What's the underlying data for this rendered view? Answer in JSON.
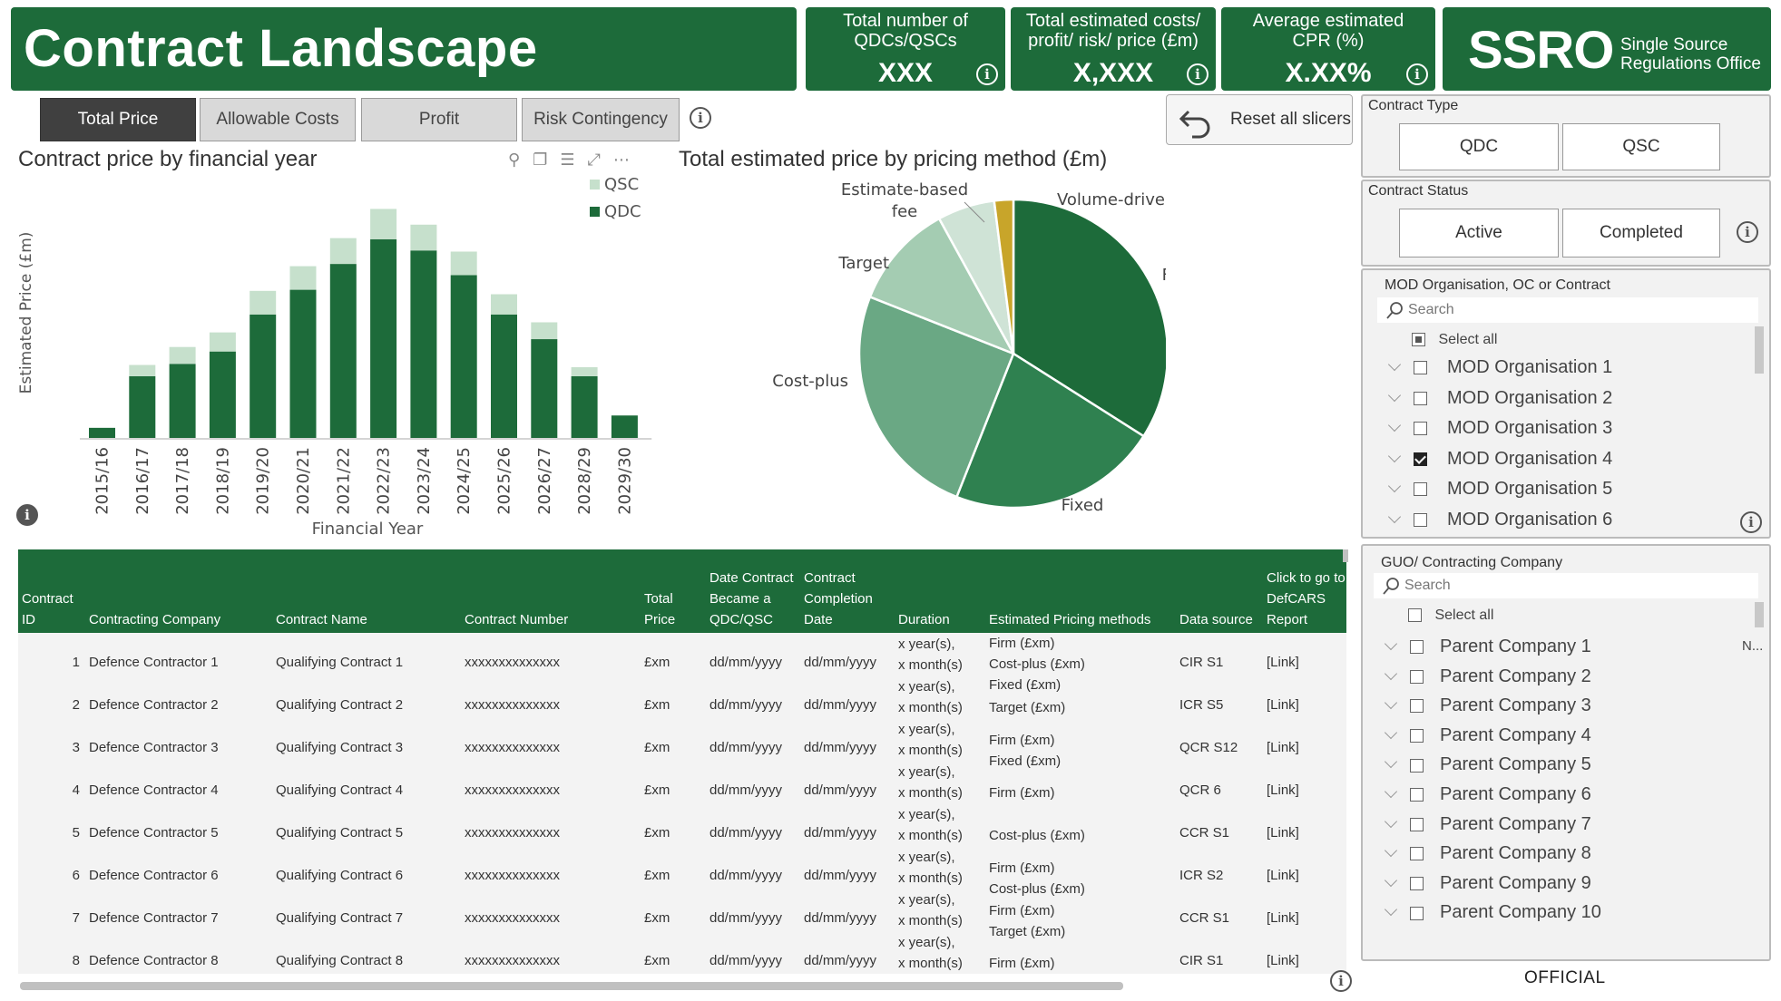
{
  "header": {
    "title": "Contract Landscape",
    "kpis": [
      {
        "label": "Total number of QDCs/QSCs",
        "value": "XXX"
      },
      {
        "label": "Total estimated costs/ profit/ risk/ price (£m)",
        "value": "X,XXX"
      },
      {
        "label": "Average estimated CPR (%)",
        "value": "X.XX%"
      }
    ],
    "logo_main": "SSRO",
    "logo_sub": "Single Source Regulations Office",
    "info_glyph": "i"
  },
  "tabs": [
    {
      "label": "Total Price",
      "active": true
    },
    {
      "label": "Allowable Costs",
      "active": false
    },
    {
      "label": "Profit",
      "active": false
    },
    {
      "label": "Risk Contingency",
      "active": false
    }
  ],
  "reset_label": "Reset all slicers",
  "bar_chart_title": "Contract price by financial year",
  "pie_chart_title": "Total estimated price by pricing method (£m)",
  "chart_data": [
    {
      "type": "bar",
      "stacked": true,
      "title": "Contract price by financial year",
      "xlabel": "Financial Year",
      "ylabel": "Estimated Price (£m)",
      "categories": [
        "2015/16",
        "2016/17",
        "2017/18",
        "2018/19",
        "2019/20",
        "2020/21",
        "2021/22",
        "2022/23",
        "2023/24",
        "2024/25",
        "2025/26",
        "2026/27",
        "2028/29",
        "2029/30"
      ],
      "series": [
        {
          "name": "QDC",
          "color": "#1d6b3a",
          "values": [
            9,
            55,
            66,
            77,
            110,
            132,
            155,
            177,
            167,
            145,
            110,
            88,
            55,
            20
          ]
        },
        {
          "name": "QSC",
          "color": "#c6e0cc",
          "values": [
            0,
            10,
            15,
            17,
            21,
            21,
            23,
            27,
            23,
            21,
            18,
            15,
            8,
            0
          ]
        }
      ],
      "legend_position": "top-right",
      "ylim": [
        0,
        210
      ],
      "grid": false
    },
    {
      "type": "pie",
      "title": "Total estimated price by pricing method (£m)",
      "slices": [
        {
          "label": "Firm",
          "value": 34,
          "color": "#1d6b3a"
        },
        {
          "label": "Fixed",
          "value": 22,
          "color": "#2f8150"
        },
        {
          "label": "Cost-plus",
          "value": 25,
          "color": "#6aa884"
        },
        {
          "label": "Target",
          "value": 11,
          "color": "#a4ccb2"
        },
        {
          "label": "Estimate-based fee",
          "value": 6,
          "color": "#cfe3d6"
        },
        {
          "label": "Volume-driven",
          "value": 2,
          "color": "#c8a52a"
        }
      ]
    }
  ],
  "slicers": {
    "contract_type": {
      "title": "Contract Type",
      "options": [
        "QDC",
        "QSC"
      ]
    },
    "contract_status": {
      "title": "Contract Status",
      "options": [
        "Active",
        "Completed"
      ]
    },
    "mod_org": {
      "title": "MOD Organisation, OC or Contract",
      "search_placeholder": "Search",
      "select_all": "Select all",
      "items": [
        {
          "label": "MOD Organisation 1",
          "checked": false
        },
        {
          "label": "MOD Organisation 2",
          "checked": false
        },
        {
          "label": "MOD Organisation 3",
          "checked": false
        },
        {
          "label": "MOD Organisation 4",
          "checked": true
        },
        {
          "label": "MOD Organisation 5",
          "checked": false
        },
        {
          "label": "MOD Organisation 6",
          "checked": false
        }
      ]
    },
    "guo": {
      "title": "GUO/ Contracting Company",
      "search_placeholder": "Search",
      "select_all": "Select all",
      "truncated_marker": "N...",
      "items": [
        {
          "label": "Parent Company 1"
        },
        {
          "label": "Parent Company 2"
        },
        {
          "label": "Parent Company 3"
        },
        {
          "label": "Parent Company 4"
        },
        {
          "label": "Parent Company 5"
        },
        {
          "label": "Parent Company 6"
        },
        {
          "label": "Parent Company 7"
        },
        {
          "label": "Parent Company 8"
        },
        {
          "label": "Parent Company 9"
        },
        {
          "label": "Parent Company 10"
        }
      ]
    }
  },
  "table": {
    "headers": [
      "Contract ID",
      "Contracting Company",
      "Contract Name",
      "Contract Number",
      "Total Price",
      "Date Contract Became a QDC/QSC",
      "Contract Completion Date",
      "Duration",
      "Estimated Pricing methods",
      "Data source",
      "Click to go to DefCARS Report"
    ],
    "rows": [
      {
        "id": "1",
        "company": "Defence Contractor 1",
        "name": "Qualifying Contract 1",
        "number": "xxxxxxxxxxxxxx",
        "price": "£xm",
        "became": "dd/mm/yyyy",
        "completion": "dd/mm/yyyy",
        "duration": [
          "x year(s),",
          "x month(s)"
        ],
        "methods": [
          "Firm (£xm)",
          "Cost-plus (£xm)",
          "Fixed (£xm)"
        ],
        "source": "CIR S1",
        "link": "[Link]"
      },
      {
        "id": "2",
        "company": "Defence Contractor 2",
        "name": "Qualifying Contract 2",
        "number": "xxxxxxxxxxxxxx",
        "price": "£xm",
        "became": "dd/mm/yyyy",
        "completion": "dd/mm/yyyy",
        "duration": [
          "x year(s),",
          "x month(s)"
        ],
        "methods": [
          "Target (£xm)"
        ],
        "source": "ICR S5",
        "link": "[Link]"
      },
      {
        "id": "3",
        "company": "Defence Contractor 3",
        "name": "Qualifying Contract 3",
        "number": "xxxxxxxxxxxxxx",
        "price": "£xm",
        "became": "dd/mm/yyyy",
        "completion": "dd/mm/yyyy",
        "duration": [
          "x year(s),",
          "x month(s)"
        ],
        "methods": [
          "Firm (£xm)",
          "Fixed (£xm)"
        ],
        "source": "QCR S12",
        "link": "[Link]"
      },
      {
        "id": "4",
        "company": "Defence Contractor 4",
        "name": "Qualifying Contract 4",
        "number": "xxxxxxxxxxxxxx",
        "price": "£xm",
        "became": "dd/mm/yyyy",
        "completion": "dd/mm/yyyy",
        "duration": [
          "x year(s),",
          "x month(s)"
        ],
        "methods": [
          "Firm (£xm)"
        ],
        "source": "QCR 6",
        "link": "[Link]"
      },
      {
        "id": "5",
        "company": "Defence Contractor 5",
        "name": "Qualifying Contract 5",
        "number": "xxxxxxxxxxxxxx",
        "price": "£xm",
        "became": "dd/mm/yyyy",
        "completion": "dd/mm/yyyy",
        "duration": [
          "x year(s),",
          "x month(s)"
        ],
        "methods": [
          "Cost-plus (£xm)"
        ],
        "source": "CCR S1",
        "link": "[Link]"
      },
      {
        "id": "6",
        "company": "Defence Contractor 6",
        "name": "Qualifying Contract 6",
        "number": "xxxxxxxxxxxxxx",
        "price": "£xm",
        "became": "dd/mm/yyyy",
        "completion": "dd/mm/yyyy",
        "duration": [
          "x year(s),",
          "x month(s)"
        ],
        "methods": [
          "Firm (£xm)",
          "Cost-plus (£xm)"
        ],
        "source": "ICR S2",
        "link": "[Link]"
      },
      {
        "id": "7",
        "company": "Defence Contractor 7",
        "name": "Qualifying Contract 7",
        "number": "xxxxxxxxxxxxxx",
        "price": "£xm",
        "became": "dd/mm/yyyy",
        "completion": "dd/mm/yyyy",
        "duration": [
          "x year(s),",
          "x month(s)"
        ],
        "methods": [
          "Firm (£xm)",
          "Target (£xm)"
        ],
        "source": "CCR S1",
        "link": "[Link]"
      },
      {
        "id": "8",
        "company": "Defence Contractor 8",
        "name": "Qualifying Contract 8",
        "number": "xxxxxxxxxxxxxx",
        "price": "£xm",
        "became": "dd/mm/yyyy",
        "completion": "dd/mm/yyyy",
        "duration": [
          "x year(s),",
          "x month(s)"
        ],
        "methods": [
          "Firm (£xm)"
        ],
        "source": "CIR S1",
        "link": "[Link]"
      }
    ]
  },
  "footer": {
    "classification": "OFFICIAL"
  }
}
